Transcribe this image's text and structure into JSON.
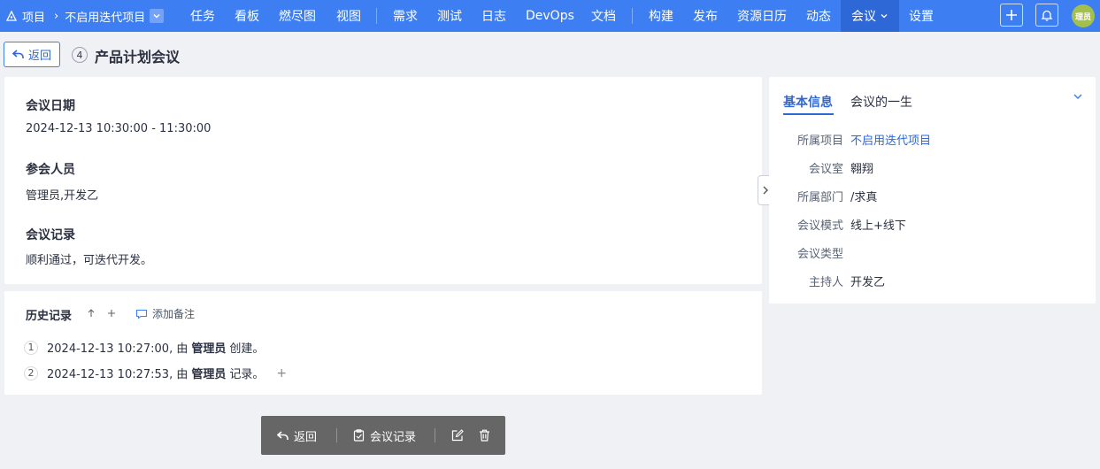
{
  "topbar": {
    "project_label": "项目",
    "current_project": "不启用迭代项目",
    "nav": [
      "任务",
      "看板",
      "燃尽图",
      "视图",
      "需求",
      "测试",
      "日志",
      "DevOps",
      "文档",
      "构建",
      "发布",
      "资源日历",
      "动态",
      "会议",
      "设置"
    ],
    "active_nav": "会议",
    "avatar_text": "理员",
    "colors": {
      "bar": "#3d7ef3",
      "active": "#2e67d6",
      "avatar": "#a4c04c"
    }
  },
  "header": {
    "back_label": "返回",
    "id": "4",
    "title": "产品计划会议"
  },
  "main": {
    "sections": [
      {
        "title": "会议日期",
        "content": "2024-12-13 10:30:00 - 11:30:00"
      },
      {
        "title": "参会人员",
        "content": "管理员,开发乙"
      },
      {
        "title": "会议记录",
        "content": "顺利通过，可迭代开发。"
      }
    ]
  },
  "history": {
    "title": "历史记录",
    "add_note_label": "添加备注",
    "entries": [
      {
        "num": "1",
        "time": "2024-12-13 10:27:00, 由",
        "user": "管理员",
        "action": "创建。"
      },
      {
        "num": "2",
        "time": "2024-12-13 10:27:53, 由",
        "user": "管理员",
        "action": "记录。"
      }
    ]
  },
  "side": {
    "tabs": [
      "基本信息",
      "会议的一生"
    ],
    "active_tab": "基本信息",
    "fields": [
      {
        "label": "所属项目",
        "value": "不启用迭代项目"
      },
      {
        "label": "会议室",
        "value": "翱翔"
      },
      {
        "label": "所属部门",
        "value": "/求真"
      },
      {
        "label": "会议模式",
        "value": "线上+线下"
      },
      {
        "label": "会议类型",
        "value": ""
      },
      {
        "label": "主持人",
        "value": "开发乙"
      }
    ]
  },
  "actions": {
    "back_label": "返回",
    "record_label": "会议记录"
  }
}
